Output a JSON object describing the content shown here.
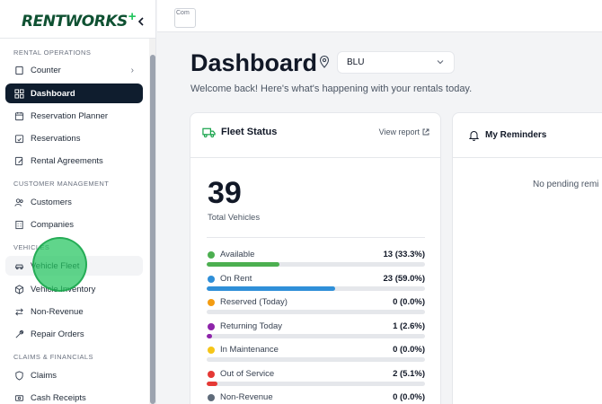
{
  "brand": {
    "name": "RENTWORKS",
    "plus": "+"
  },
  "topbar": {
    "logo_alt": "Com"
  },
  "sidebar": {
    "sections": [
      {
        "label": "RENTAL OPERATIONS"
      },
      {
        "label": "CUSTOMER MANAGEMENT"
      },
      {
        "label": "VEHICLES"
      },
      {
        "label": "CLAIMS & FINANCIALS"
      }
    ],
    "items": [
      {
        "label": "Counter",
        "icon": "square-icon",
        "has_chevron": true,
        "chevron": "›"
      },
      {
        "label": "Dashboard",
        "icon": "dashboard-icon",
        "active": true
      },
      {
        "label": "Reservation Planner",
        "icon": "calendar-icon"
      },
      {
        "label": "Reservations",
        "icon": "calendar-check-icon"
      },
      {
        "label": "Rental Agreements",
        "icon": "document-edit-icon"
      },
      {
        "label": "Customers",
        "icon": "users-icon"
      },
      {
        "label": "Companies",
        "icon": "building-icon"
      },
      {
        "label": "Vehicle Fleet",
        "icon": "car-icon"
      },
      {
        "label": "Vehicle Inventory",
        "icon": "box-icon"
      },
      {
        "label": "Non-Revenue",
        "icon": "arrows-swap-icon"
      },
      {
        "label": "Repair Orders",
        "icon": "wrench-icon"
      },
      {
        "label": "Claims",
        "icon": "shield-icon"
      },
      {
        "label": "Cash Receipts",
        "icon": "receipt-icon"
      }
    ]
  },
  "main": {
    "title": "Dashboard",
    "location": {
      "value": "BLU"
    },
    "welcome": "Welcome back! Here's what's happening with your rentals today."
  },
  "fleet": {
    "title": "Fleet Status",
    "view_report": "View report",
    "total": "39",
    "total_label": "Total Vehicles",
    "statuses": [
      {
        "label": "Available",
        "count": "13 (33.3%)",
        "percent": 33.3,
        "color": "#4caf50"
      },
      {
        "label": "On Rent",
        "count": "23 (59.0%)",
        "percent": 59.0,
        "color": "#2f8fd8"
      },
      {
        "label": "Reserved (Today)",
        "count": "0 (0.0%)",
        "percent": 0.0,
        "color": "#f39c12"
      },
      {
        "label": "Returning Today",
        "count": "1 (2.6%)",
        "percent": 2.6,
        "color": "#8e24aa"
      },
      {
        "label": "In Maintenance",
        "count": "0 (0.0%)",
        "percent": 0.0,
        "color": "#f5c518"
      },
      {
        "label": "Out of Service",
        "count": "2 (5.1%)",
        "percent": 5.1,
        "color": "#e53935"
      },
      {
        "label": "Non-Revenue",
        "count": "0 (0.0%)",
        "percent": 0.0,
        "color": "#5f6b7a"
      }
    ]
  },
  "reminders": {
    "title": "My Reminders",
    "empty": "No pending remi"
  }
}
